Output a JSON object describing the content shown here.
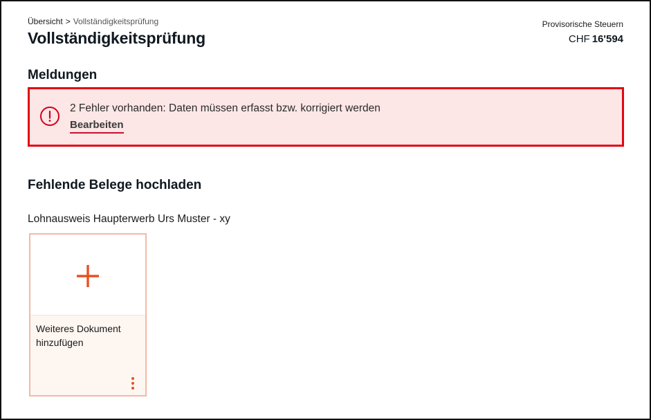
{
  "breadcrumb": {
    "root": "Übersicht",
    "separator": ">",
    "current": "Vollständigkeitsprüfung"
  },
  "page": {
    "title": "Vollständigkeitsprüfung"
  },
  "taxes": {
    "label": "Provisorische Steuern",
    "currency": "CHF",
    "amount": "16'594"
  },
  "messages": {
    "title": "Meldungen",
    "alert": {
      "icon": "exclamation-circle-icon",
      "text": "2 Fehler vorhanden: Daten müssen erfasst bzw. korrigiert werden",
      "link": "Bearbeiten"
    }
  },
  "uploads": {
    "title": "Fehlende Belege hochladen",
    "document_label": "Lohnausweis Haupterwerb Urs Muster - xy",
    "card": {
      "icon": "plus-icon",
      "text": "Weiteres Dokument hinzufügen",
      "menu_icon": "kebab-menu-icon"
    }
  },
  "colors": {
    "error": "#e30613",
    "error_bg": "#fce6e6",
    "accent": "#e8501e",
    "card_border": "#f3b9a5",
    "card_bg": "#fdf6f1"
  }
}
